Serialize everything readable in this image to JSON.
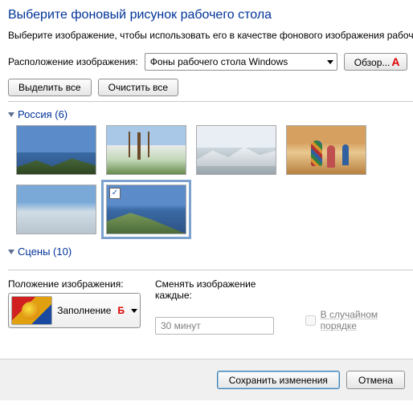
{
  "title": "Выберите фоновый рисунок рабочего стола",
  "description": "Выберите изображение, чтобы использовать его в качестве фонового изображения рабочего стола, или выберите несколько изображений, чтобы создать слайд-шоу.",
  "location_label": "Расположение изображения:",
  "location_value": "Фоны рабочего стола Windows",
  "browse_label": "Обзор...",
  "annotation_a": "А",
  "select_all_label": "Выделить все",
  "clear_all_label": "Очистить все",
  "group_russia": "Россия (6)",
  "group_scenes": "Сцены (10)",
  "position_label": "Положение изображения:",
  "position_value": "Заполнение",
  "annotation_b": "Б",
  "interval_label": "Сменять изображение каждые:",
  "interval_value": "30 минут",
  "shuffle_label": "В случайном порядке",
  "save_label": "Сохранить изменения",
  "cancel_label": "Отмена"
}
